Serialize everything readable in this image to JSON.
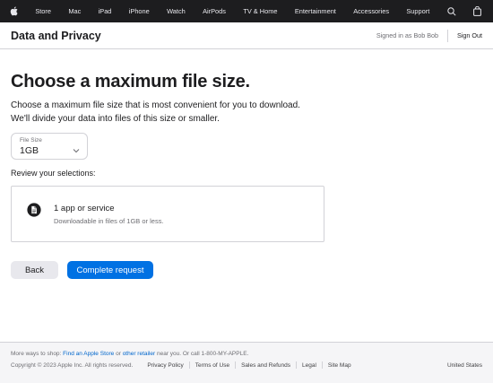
{
  "global_nav": {
    "items": [
      "Store",
      "Mac",
      "iPad",
      "iPhone",
      "Watch",
      "AirPods",
      "TV & Home",
      "Entertainment",
      "Accessories",
      "Support"
    ],
    "icons": [
      "apple-logo-icon",
      "search-icon",
      "bag-icon"
    ]
  },
  "local_nav": {
    "title": "Data and Privacy",
    "signed_in": "Signed in as Bob Bob",
    "sign_out": "Sign Out"
  },
  "main": {
    "heading": "Choose a maximum file size.",
    "description_line1": "Choose a maximum file size that is most convenient for you to download.",
    "description_line2": "We'll divide your data into files of this size or smaller.",
    "file_size": {
      "label": "File Size",
      "value": "1GB"
    },
    "review_label": "Review your selections:",
    "selection": {
      "title": "1 app or service",
      "subtitle": "Downloadable in files of 1GB or less."
    },
    "back_label": "Back",
    "complete_label": "Complete request"
  },
  "footer": {
    "shop_prefix": "More ways to shop: ",
    "find_store": "Find an Apple Store",
    "or": " or ",
    "other_retailer": "other retailer",
    "shop_suffix": " near you. Or call 1-800-MY-APPLE.",
    "copyright": "Copyright © 2023 Apple Inc. All rights reserved.",
    "legal_links": [
      "Privacy Policy",
      "Terms of Use",
      "Sales and Refunds",
      "Legal",
      "Site Map"
    ],
    "country": "United States"
  },
  "colors": {
    "nav_bg": "#1d1d1f",
    "accent": "#0071e3",
    "link": "#0066cc",
    "footer_bg": "#f5f5f7"
  }
}
